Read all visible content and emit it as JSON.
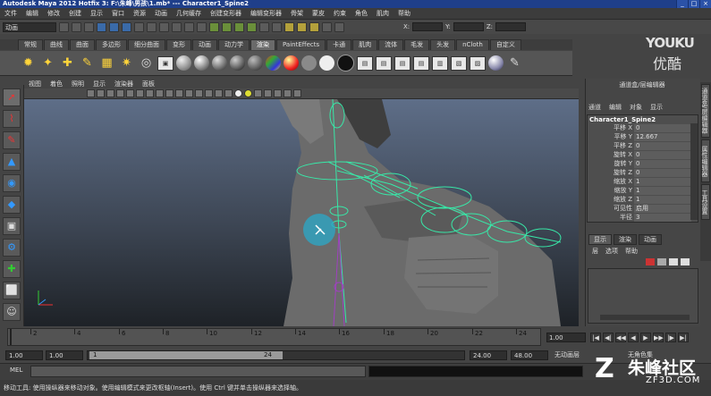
{
  "title": "Autodesk Maya 2012 Hotfix 3: F:\\朱峰\\男孩\\1.mb* --- Character1_Spine2",
  "window_buttons": [
    "_",
    "□",
    "×"
  ],
  "menu": [
    "文件",
    "编辑",
    "修改",
    "创建",
    "显示",
    "窗口",
    "资源",
    "动画",
    "几何缓存",
    "创建变形器",
    "编辑变形器",
    "骨架",
    "蒙皮",
    "约束",
    "角色",
    "肌肉",
    "帮助"
  ],
  "status_line": {
    "mode": "动画",
    "x_label": "X:",
    "y_label": "Y:",
    "z_label": "Z:"
  },
  "shelf_tabs": [
    "常规",
    "曲线",
    "曲面",
    "多边形",
    "细分曲面",
    "变形",
    "动画",
    "动力学",
    "渲染",
    "PaintEffects",
    "卡通",
    "肌肉",
    "流体",
    "毛发",
    "头发",
    "nCloth",
    "自定义"
  ],
  "shelf_active_index": 8,
  "panel_menu": [
    "视图",
    "着色",
    "照明",
    "显示",
    "渲染器",
    "面板"
  ],
  "channel_box": {
    "title": "通道盒/层编辑器",
    "menu": [
      "通道",
      "编辑",
      "对象",
      "显示"
    ],
    "object": "Character1_Spine2",
    "rows": [
      {
        "label": "平移 X",
        "value": "0"
      },
      {
        "label": "平移 Y",
        "value": "12.667"
      },
      {
        "label": "平移 Z",
        "value": "0"
      },
      {
        "label": "旋转 X",
        "value": "0"
      },
      {
        "label": "旋转 Y",
        "value": "0"
      },
      {
        "label": "旋转 Z",
        "value": "0"
      },
      {
        "label": "缩放 X",
        "value": "1"
      },
      {
        "label": "缩放 Y",
        "value": "1"
      },
      {
        "label": "缩放 Z",
        "value": "1"
      },
      {
        "label": "可见性",
        "value": "启用"
      },
      {
        "label": "半径",
        "value": "3"
      }
    ]
  },
  "layer_editor": {
    "tabs": [
      "显示",
      "渲染",
      "动画"
    ],
    "menu": [
      "层",
      "选项",
      "帮助"
    ]
  },
  "side_tabs": [
    "通道盒/层编辑器",
    "属性编辑器",
    "工具设置"
  ],
  "time_slider": {
    "ticks": [
      "2",
      "4",
      "6",
      "8",
      "10",
      "12",
      "14",
      "16",
      "18",
      "20",
      "22",
      "24"
    ],
    "current_frame": "1.00",
    "playback_buttons": [
      "|◀",
      "◀|",
      "◀◀",
      "◀",
      "▶",
      "▶▶",
      "|▶",
      "▶|"
    ]
  },
  "range_slider": {
    "start": "1.00",
    "anim_start": "1.00",
    "handle_start": "1",
    "handle_end": "24",
    "end": "24.00",
    "anim_end": "48.00",
    "anim_layer": "无动画层",
    "char_set": "无角色集"
  },
  "command_line": {
    "label": "MEL"
  },
  "help_line": "移动工具: 使用操纵器来移动对象。使用编辑模式来更改枢轴(Insert)。使用 Ctrl 键并单击操纵器来选择轴。",
  "watermarks": {
    "youku": "YOUKU",
    "youku_cn": "优酷",
    "zhufeng": "朱峰社区",
    "zf3d": "ZF3D.COM"
  },
  "colors": {
    "rig": "#38e8a8",
    "joint": "#a040c0",
    "accent": "#1f3f8a"
  }
}
